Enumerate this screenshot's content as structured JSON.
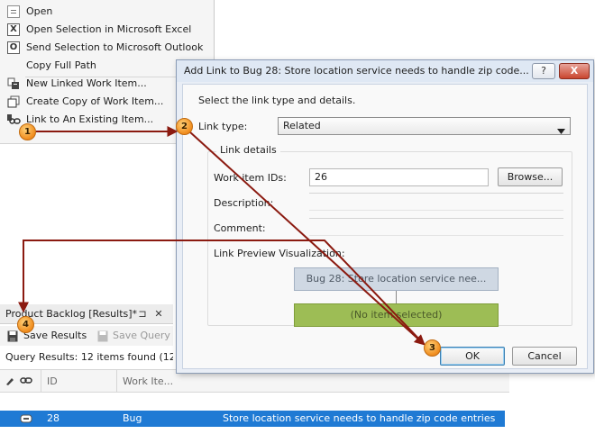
{
  "context_menu": {
    "items": [
      {
        "label": "Open",
        "icon": "open-icon"
      },
      {
        "label": "Open Selection in Microsoft Excel",
        "icon": "excel-icon"
      },
      {
        "label": "Send Selection to Microsoft Outlook",
        "icon": "outlook-icon"
      },
      {
        "label": "Copy Full Path",
        "icon": ""
      },
      {
        "label": "New Linked Work Item...",
        "icon": "new-linked-icon"
      },
      {
        "label": "Create Copy of Work Item...",
        "icon": "copy-item-icon"
      },
      {
        "label": "Link to An Existing Item...",
        "icon": "link-icon"
      }
    ]
  },
  "dialog": {
    "title": "Add Link to Bug 28: Store location service needs to handle zip code...",
    "help_label": "?",
    "close_label": "X",
    "instruction": "Select the link type and details.",
    "link_type_label": "Link type:",
    "link_type_value": "Related",
    "group_label": "Link details",
    "work_item_ids_label": "Work item IDs:",
    "work_item_ids_value": "26",
    "browse_label": "Browse...",
    "description_label": "Description:",
    "comment_label": "Comment:",
    "preview_label": "Link Preview Visualization:",
    "preview_source": "Bug 28: Store location service nee...",
    "preview_target": "(No item selected)",
    "ok_label": "OK",
    "cancel_label": "Cancel"
  },
  "panel": {
    "title": "Product Backlog [Results]*",
    "pin_label": "⊐",
    "close_label": "✕",
    "save_results_label": "Save Results",
    "save_query_label": "Save Query",
    "status": "Query Results: 12 items found (12..."
  },
  "grid": {
    "headers": [
      "ID",
      "Work Ite..."
    ],
    "row": {
      "id": "28",
      "type": "Bug",
      "title": "Store location service needs to handle zip code entries"
    }
  },
  "callouts": [
    "1",
    "2",
    "3",
    "4"
  ],
  "colors": {
    "accent": "#1f7ad4",
    "callout": "#f08c1d",
    "arrow": "#8b1a10"
  }
}
